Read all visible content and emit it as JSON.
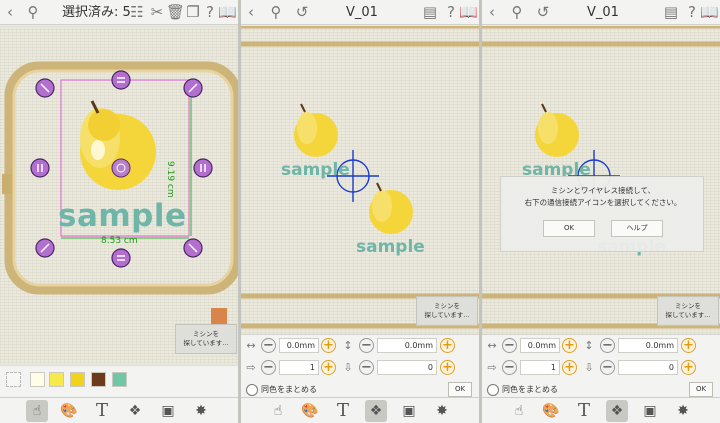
{
  "screens": [
    {
      "title": "選択済み: 5",
      "icons": [
        "back-icon",
        "search-icon",
        "select-all-icon",
        "cut-icon",
        "delete-icon",
        "help-icon",
        "manual-icon"
      ],
      "design": {
        "text": "sample",
        "width_label": "8.53 cm",
        "height_label": "9.19 cm"
      },
      "thread_colors": [
        "#fffde8",
        "#f6e94a",
        "#f2d21c",
        "#6b3b1b",
        "#6fc7a8"
      ],
      "toast": "ミシンを\n探しています...",
      "bottom_nav": [
        "touch",
        "palette",
        "text",
        "combine",
        "frame",
        "effects"
      ],
      "active_nav": 0
    },
    {
      "title": "V_01",
      "icons": [
        "back-icon",
        "search-icon",
        "undo-icon",
        "send-icon",
        "help-icon",
        "manual-icon"
      ],
      "design": {
        "text": "sample"
      },
      "controls": {
        "move_h": "0.0mm",
        "move_v": "0.0mm",
        "count_h": "1",
        "count_v": "0",
        "merge_label": "同色をまとめる",
        "ok_label": "OK"
      },
      "toast": "ミシンを\n探しています...",
      "bottom_nav": [
        "touch",
        "palette",
        "text",
        "combine",
        "frame",
        "effects"
      ],
      "active_nav": 3
    },
    {
      "title": "V_01",
      "icons": [
        "back-icon",
        "search-icon",
        "undo-icon",
        "send-icon",
        "help-icon",
        "manual-icon"
      ],
      "design": {
        "text": "sample"
      },
      "controls": {
        "move_h": "0.0mm",
        "move_v": "0.0mm",
        "count_h": "1",
        "count_v": "0",
        "merge_label": "同色をまとめる",
        "ok_label": "OK"
      },
      "toast": "ミシンを\n探しています...",
      "dialog": {
        "message_line1": "ミシンとワイヤレス接続して、",
        "message_line2": "右下の通信接続アイコンを選択してください。",
        "ok_label": "OK",
        "help_label": "ヘルプ"
      },
      "bottom_nav": [
        "touch",
        "palette",
        "text",
        "combine",
        "frame",
        "effects"
      ],
      "active_nav": 3
    }
  ]
}
